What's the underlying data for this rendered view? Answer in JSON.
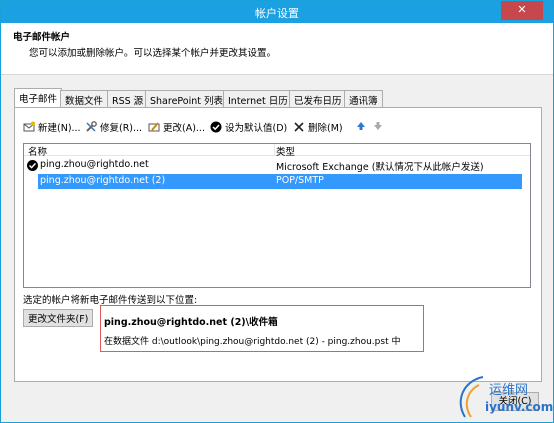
{
  "window": {
    "title": "帐户设置",
    "close_glyph": "✕"
  },
  "header": {
    "title": "电子邮件帐户",
    "subtitle": "您可以添加或删除帐户。可以选择某个帐户并更改其设置。"
  },
  "tabs": [
    {
      "label": "电子邮件",
      "active": true
    },
    {
      "label": "数据文件"
    },
    {
      "label": "RSS 源"
    },
    {
      "label": "SharePoint 列表"
    },
    {
      "label": "Internet 日历"
    },
    {
      "label": "已发布日历"
    },
    {
      "label": "通讯簿"
    }
  ],
  "toolbar": {
    "new": "新建(N)...",
    "repair": "修复(R)...",
    "change": "更改(A)...",
    "set_default": "设为默认值(D)",
    "remove": "删除(M)"
  },
  "list": {
    "col_name": "名称",
    "col_type": "类型",
    "rows": [
      {
        "name": "ping.zhou@rightdo.net",
        "type": "Microsoft Exchange (默认情况下从此帐户发送)",
        "default": true
      },
      {
        "name": "ping.zhou@rightdo.net (2)",
        "type": "POP/SMTP",
        "selected": true
      }
    ]
  },
  "delivery": {
    "label": "选定的帐户将新电子邮件传送到以下位置:",
    "change_folder": "更改文件夹(F)",
    "folder": "ping.zhou@rightdo.net (2)\\收件箱",
    "path": "在数据文件 d:\\outlook\\ping.zhou@rightdo.net (2) - ping.zhou.pst 中"
  },
  "footer": {
    "close": "关闭(C)"
  },
  "watermark": {
    "line1": "运维网",
    "line2": "iyunv.com"
  },
  "colors": {
    "titlebar": "#1ba1e2",
    "selection": "#3399ff",
    "highlight_border": "#e05a5a"
  }
}
